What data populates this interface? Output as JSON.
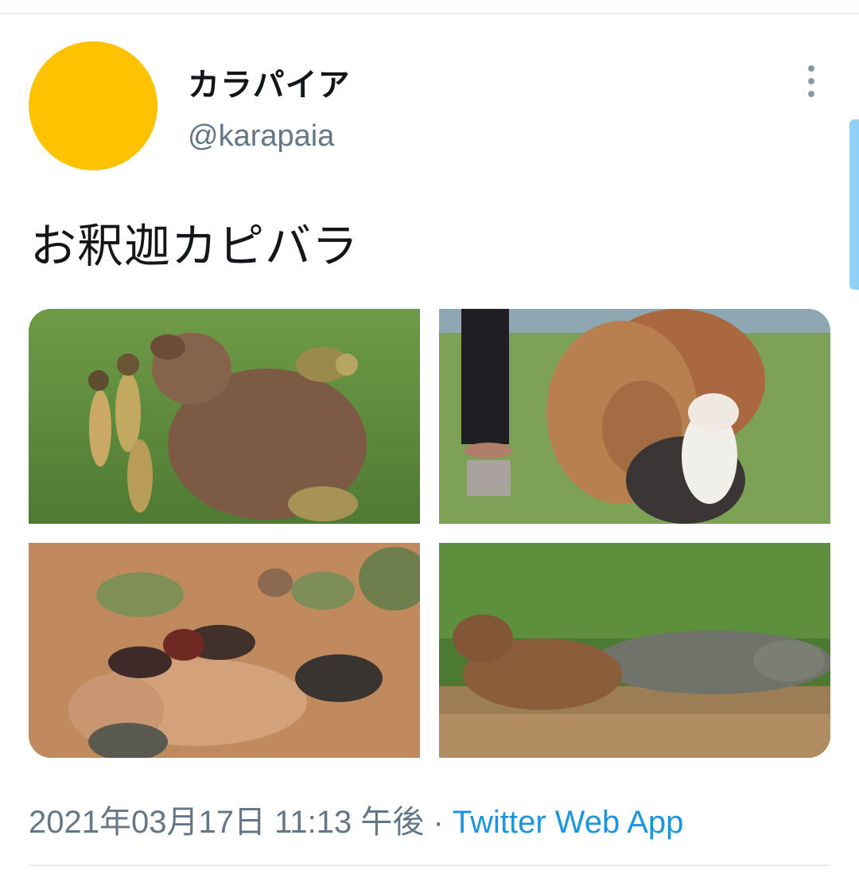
{
  "tweet": {
    "author": {
      "display_name": "カラパイア",
      "handle": "@karapaia",
      "avatar_color": "#fec200"
    },
    "more_icon": "more-vertical-icon",
    "text": "お釈迦カピバラ",
    "media": [
      {
        "subject": "capybara with squirrel monkeys"
      },
      {
        "subject": "capybara hugging cat"
      },
      {
        "subject": "capybara with ducks and turtles"
      },
      {
        "subject": "capybara next to caiman"
      }
    ],
    "timestamp": "2021年03月17日 11:13 午後",
    "separator": " · ",
    "source": "Twitter Web App",
    "colors": {
      "text": "#14171a",
      "secondary": "#657786",
      "link": "#1b95e0"
    }
  }
}
